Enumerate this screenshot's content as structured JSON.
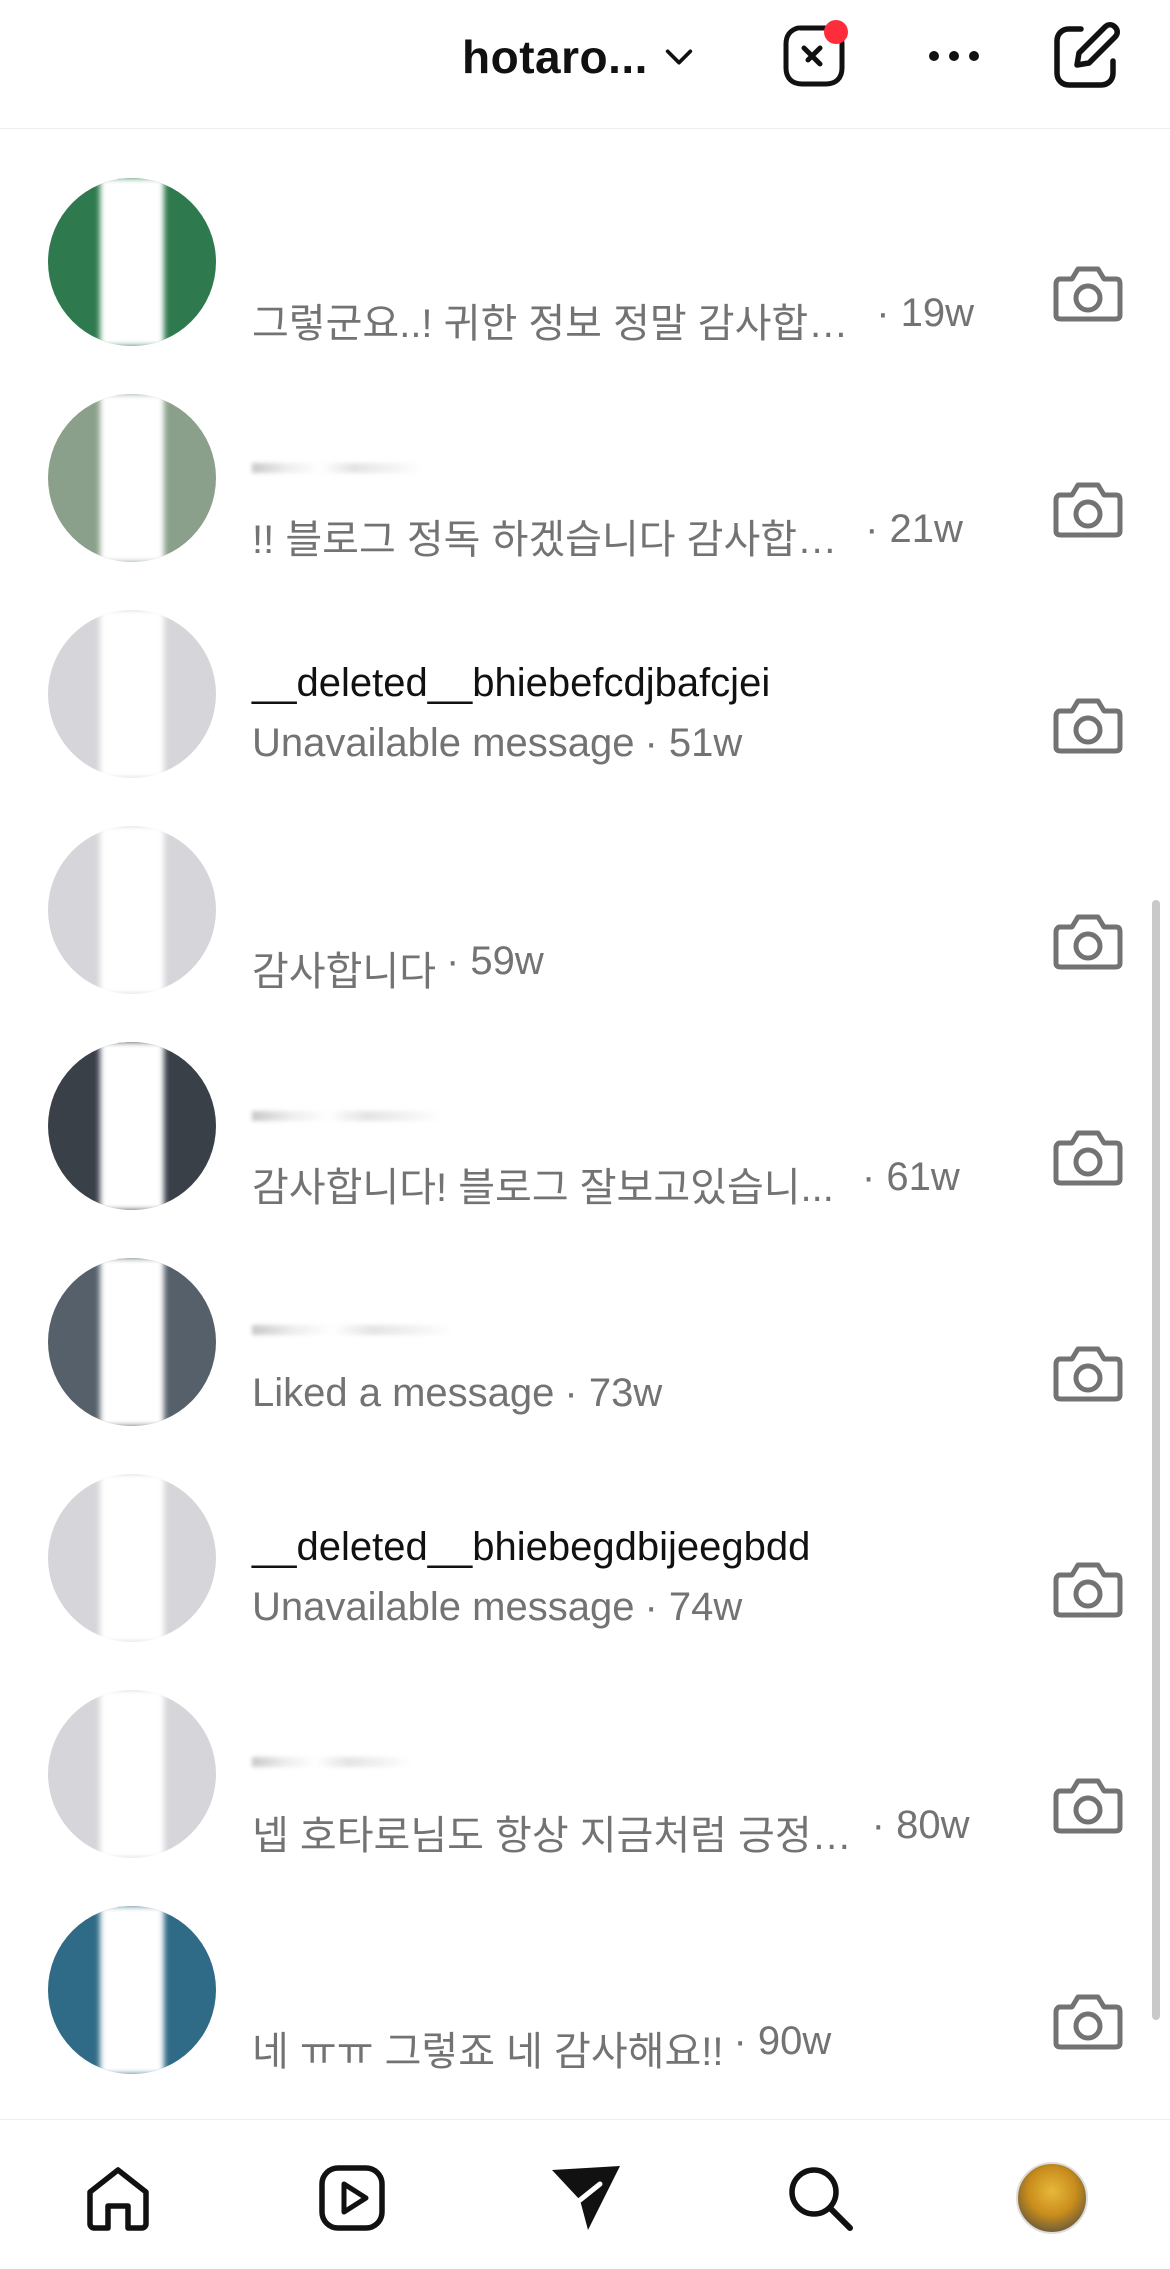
{
  "header": {
    "account_name": "hotaro...",
    "icons": [
      "chevron-down-icon",
      "notes-icon",
      "more-icon",
      "compose-icon"
    ],
    "notification_dot_color": "#ff2d3c"
  },
  "conversations": [
    {
      "name": "",
      "snippet": "그렇군요..! 귀한 정보 정말 감사합…",
      "time": "· 19w"
    },
    {
      "name": "",
      "snippet": "!! 블로그 정독 하겠습니다 감사합…",
      "time": "· 21w"
    },
    {
      "name": "__deleted__bhiebefcdjbafcjei",
      "snippet": "Unavailable message",
      "time": "· 51w"
    },
    {
      "name": "",
      "snippet": "감사합니다",
      "time": "· 59w"
    },
    {
      "name": "",
      "snippet": "감사합니다! 블로그 잘보고있습니...",
      "time": "· 61w"
    },
    {
      "name": "",
      "snippet": "Liked a message",
      "time": "· 73w"
    },
    {
      "name": "__deleted__bhiebegdbijeegbdd",
      "snippet": "Unavailable message",
      "time": "· 74w"
    },
    {
      "name": "",
      "snippet": "넵 호타로님도 항상 지금처럼 긍정…",
      "time": "· 80w"
    },
    {
      "name": "",
      "snippet": "네 ㅠㅠ 그렇죠 네 감사해요!!",
      "time": "· 90w"
    }
  ],
  "bottom_nav": {
    "items": [
      "home-icon",
      "reels-icon",
      "messages-icon",
      "search-icon",
      "profile-avatar"
    ]
  }
}
